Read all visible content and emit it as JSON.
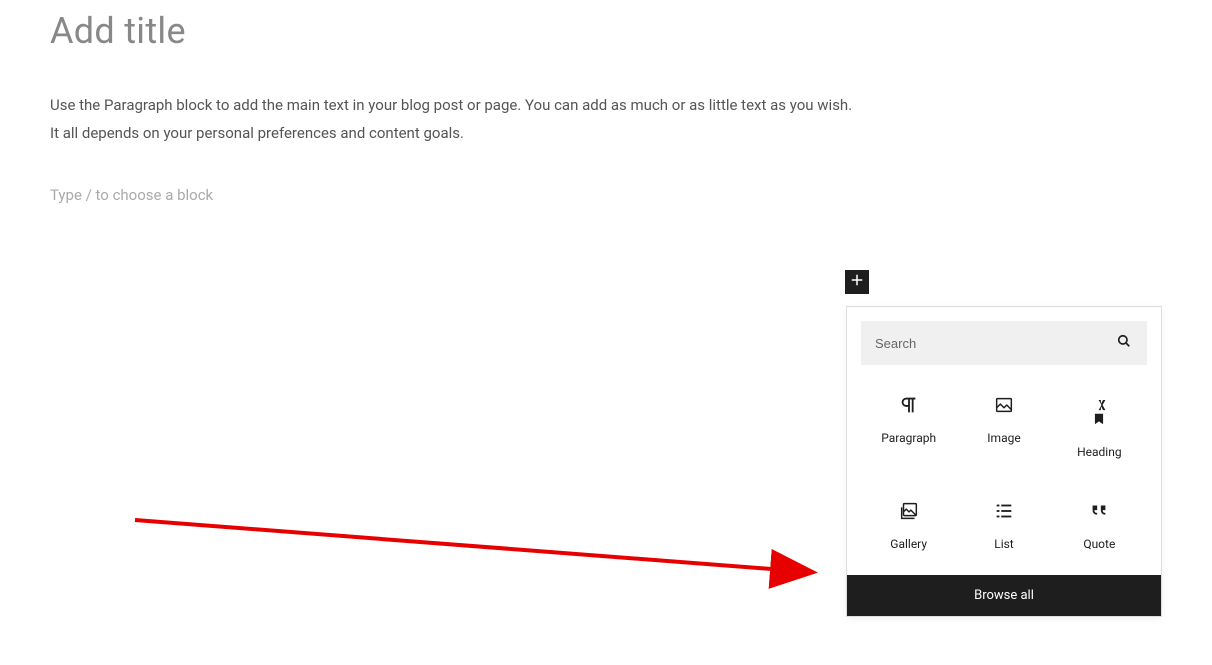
{
  "editor": {
    "title_placeholder": "Add title",
    "paragraph_line1": "Use the Paragraph block to add the main text in your blog post or page. You can add as much or as little text as you wish.",
    "paragraph_line2": "It all depends on your personal preferences and content goals.",
    "block_placeholder": "Type / to choose a block"
  },
  "inserter": {
    "search_placeholder": "Search",
    "blocks": [
      {
        "label": "Paragraph",
        "icon": "paragraph"
      },
      {
        "label": "Image",
        "icon": "image"
      },
      {
        "label": "Heading",
        "icon": "heading"
      },
      {
        "label": "Gallery",
        "icon": "gallery"
      },
      {
        "label": "List",
        "icon": "list"
      },
      {
        "label": "Quote",
        "icon": "quote"
      }
    ],
    "browse_all": "Browse all"
  }
}
